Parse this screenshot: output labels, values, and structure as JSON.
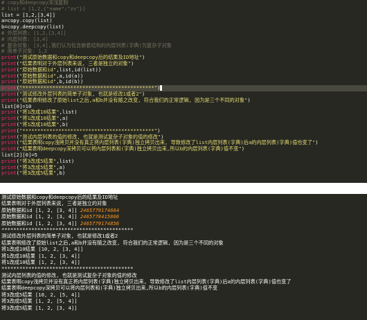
{
  "code": [
    {
      "t": "comment",
      "a": "# copy和deepcopy深浅复制"
    },
    {
      "t": "comment",
      "a": "# list = [1,2,{\"name\":\"zs\"}]"
    },
    {
      "t": "assign",
      "a": "list = [1,2,[3,4]]"
    },
    {
      "t": "assign",
      "a": "a=copy.copy(list)"
    },
    {
      "t": "assign",
      "a": "b=copy.deepcopy(list)"
    },
    {
      "t": "comment",
      "a": "# 外层列表: [1,2,[3,4]]"
    },
    {
      "t": "comment",
      "a": "# 内层列表: [3,4]"
    },
    {
      "t": "comment",
      "a": "# 复杂对象: [3,4],我们认为包含嵌套结构的内层列表(字典)为复杂子对象"
    },
    {
      "t": "comment",
      "a": "# 简单子对象: 1,2"
    },
    {
      "t": "print",
      "a": "\"测试原始数据和copy和deepcopy后的结果及ID地址\""
    },
    {
      "t": "print",
      "a": "\"结果表明对于外层列表来说, 三者是独立的对象\""
    },
    {
      "t": "print",
      "a": "\"原始数据和id\"",
      "b": ",list,id(list)"
    },
    {
      "t": "print",
      "a": "\"原始数据和id\"",
      "b": ",a,id(a)"
    },
    {
      "t": "print",
      "a": "\"原始数据和id\"",
      "b": ",b,id(b)"
    },
    {
      "t": "print",
      "a": "\"********************************************\"",
      "hl": true
    },
    {
      "t": "print",
      "a": "\"测试修改外层列表的简单子对象, 也就是修改1或者2\""
    },
    {
      "t": "print",
      "a": "\"结果表明修改了原始list之后,a和b并没有随之改变, 符合我们的正常逻辑, 因为是三个不同的对象\""
    },
    {
      "t": "assign",
      "a": "list[0]=10"
    },
    {
      "t": "print",
      "a": "\"将1改成10结果\"",
      "b": ",list"
    },
    {
      "t": "print",
      "a": "\"将1改成10结果\"",
      "b": ",a"
    },
    {
      "t": "print",
      "a": "\"将1改成10结果\"",
      "b": ",b"
    },
    {
      "t": "print",
      "a": "\"********************************************\""
    },
    {
      "t": "print",
      "a": "\"测试内层列表的值的修改, 也就是测试复杂子对象的值的修改\""
    },
    {
      "t": "print",
      "a": "\"结果表明copy浅拷贝并没有真正将内层列表(字典)独立拷贝出来, 导致修改了list内层列表(字典)后a的内层列表(字典)值也变了\""
    },
    {
      "t": "print",
      "a": "\"结果表明deepcopy深拷贝可以将内层列表和(字典)独立拷贝出来,所以b的内层列表(字典)值不变\""
    },
    {
      "t": "assign",
      "a": "list[2][0]=5"
    },
    {
      "t": "print",
      "a": "\"将3改成5结果\"",
      "b": ",list"
    },
    {
      "t": "print",
      "a": "\"将3改成5结果\"",
      "b": ",a"
    },
    {
      "t": "print",
      "a": "\"将3改成5结果\"",
      "b": ",b"
    }
  ],
  "print_kw": "print",
  "output": [
    {
      "a": "测试原始数据和copy和deepcopy后的结果及ID地址"
    },
    {
      "a": "结果表明对于外层列表来说, 三者是独立的对象"
    },
    {
      "a": "原始数据和id [1, 2, [3, 4]] ",
      "id": "2465779174664"
    },
    {
      "a": "原始数据和id [1, 2, [3, 4]] ",
      "id": "2465778415866"
    },
    {
      "a": "原始数据和id [1, 2, [3, 4]] ",
      "id": "2465779174856"
    },
    {
      "a": "********************************************"
    },
    {
      "a": "测试修改外层列表的简单子对象, 也就是修改1或者2"
    },
    {
      "a": "结果表明修改了原始list之后,a和b并没有随之改变, 符合我们的正常逻辑, 因为是三个不同的对象"
    },
    {
      "a": "将1改成10结果 [10, 2, [3, 4]]"
    },
    {
      "a": "将1改成10结果 [1, 2, [3, 4]]"
    },
    {
      "a": "将1改成10结果 [1, 2, [3, 4]]"
    },
    {
      "a": "********************************************"
    },
    {
      "a": "测试内层列表的值的修改, 也就是测试复杂子对象的值的修改"
    },
    {
      "a": "结果表明copy浅拷贝并没有真正将内层列表(字典)独立拷贝出来, 导致修改了list内层列表(字典)后a的内层列表(字典)值也变了"
    },
    {
      "a": "结果表明deepcopy深拷贝可以将内层列表和(字典)独立拷贝出来,所以b的内层列表(字典)值不变"
    },
    {
      "a": "将3改成5结果 [10, 2, [5, 4]]"
    },
    {
      "a": "将3改成5结果 [1, 2, [5, 4]]"
    },
    {
      "a": "将3改成5结果 [1, 2, [3, 4]]"
    }
  ]
}
